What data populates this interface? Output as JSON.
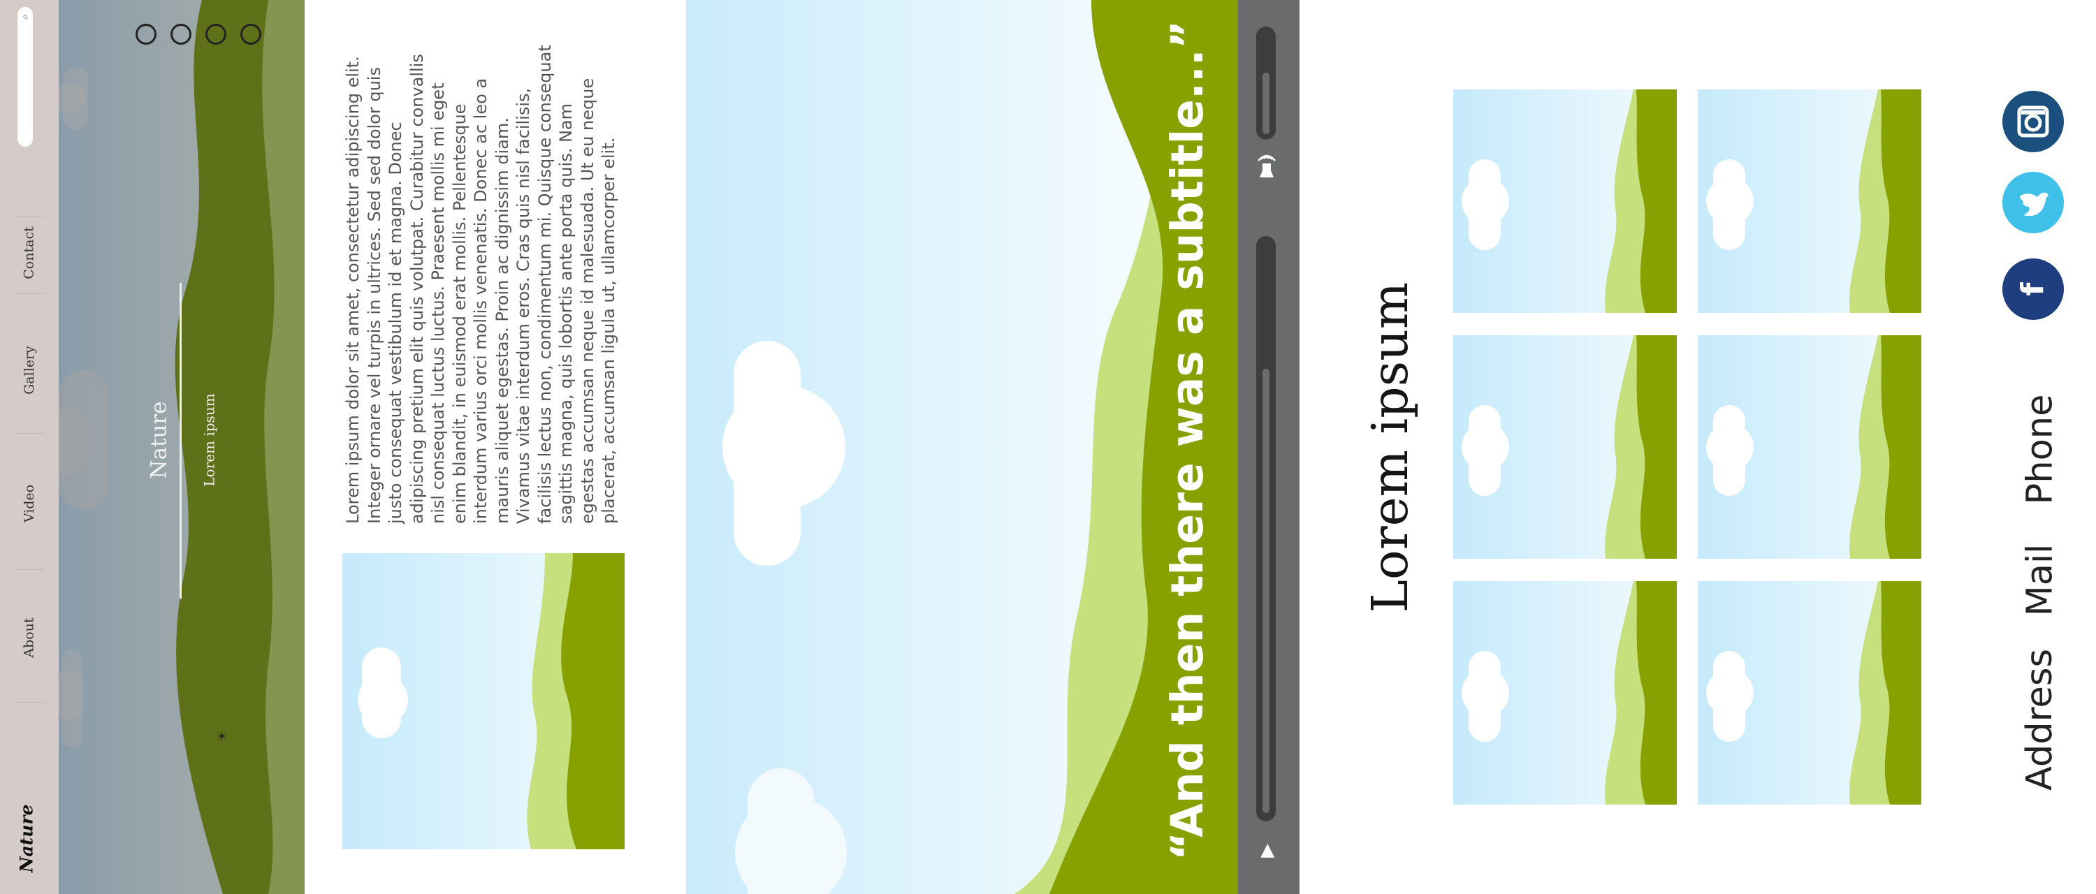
{
  "colors": {
    "nav_bg": "#d5cbc8",
    "hill_dark": "#87a200",
    "hill_light": "#c6e07e",
    "sky": "#cfeefc",
    "player_bg": "#6a6b6d",
    "instagram": "#1b4f7e",
    "twitter": "#3ec0e8",
    "facebook": "#1f3e7f"
  },
  "nav": {
    "brand": "Nature",
    "search_icon": "search-icon",
    "items": [
      {
        "label": "About"
      },
      {
        "label": "Video"
      },
      {
        "label": "Gallery"
      },
      {
        "label": "Contact"
      }
    ]
  },
  "hero": {
    "title": "Nature",
    "subtitle": "Lorem ipsum",
    "dot_count": 4
  },
  "text_section": {
    "body": "Lorem ipsum dolor sit amet, consectetur adipiscing elit. Integer ornare vel turpis in ultrices. Sed sed dolor quis justo consequat vestibulum id et magna. Donec adipiscing pretium elit quis volutpat. Curabitur convallis nisl consequat luctus luctus. Praesent mollis mi eget enim blandit, in euismod erat mollis. Pellentesque interdum varius orci mollis venenatis. Donec ac leo a mauris aliquet egestas. Proin ac dignissim diam. Vivamus vitae interdum eros. Cras quis nisl facilisis, facilisis lectus non, condimentum mi. Quisque consequat sagittis magna, quis lobortis ante porta quis. Nam egestas accumsan neque id malesuada. Ut eu neque placerat, accumsan ligula ut, ullamcorper elit."
  },
  "quote": {
    "text": "“And then there was a subtitle...”"
  },
  "player": {
    "play_icon": "play-icon",
    "volume_icon": "volume-icon"
  },
  "gallery": {
    "title": "Lorem ipsum",
    "thumb_count": 6
  },
  "contact": {
    "items": [
      {
        "label": "Address"
      },
      {
        "label": "Mail"
      },
      {
        "label": "Phone"
      }
    ],
    "social": [
      {
        "icon": "instagram-icon"
      },
      {
        "icon": "twitter-icon"
      },
      {
        "icon": "facebook-icon"
      }
    ]
  }
}
